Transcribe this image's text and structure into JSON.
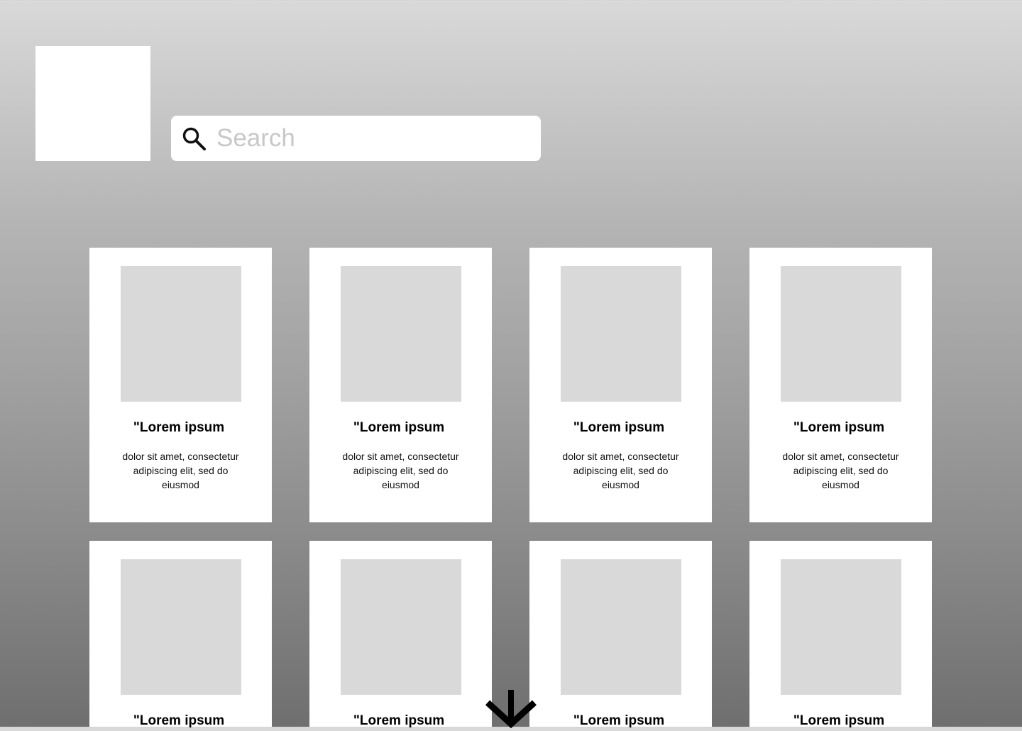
{
  "search": {
    "placeholder": "Search",
    "value": ""
  },
  "cards": [
    {
      "title": "\"Lorem ipsum",
      "description": "dolor sit amet, consectetur adipiscing elit, sed do eiusmod"
    },
    {
      "title": "\"Lorem ipsum",
      "description": "dolor sit amet, consectetur adipiscing elit, sed do eiusmod"
    },
    {
      "title": "\"Lorem ipsum",
      "description": "dolor sit amet, consectetur adipiscing elit, sed do eiusmod"
    },
    {
      "title": "\"Lorem ipsum",
      "description": "dolor sit amet, consectetur adipiscing elit, sed do eiusmod"
    },
    {
      "title": "\"Lorem ipsum",
      "description": ""
    },
    {
      "title": "\"Lorem ipsum",
      "description": ""
    },
    {
      "title": "\"Lorem ipsum",
      "description": ""
    },
    {
      "title": "\"Lorem ipsum",
      "description": ""
    }
  ],
  "icons": {
    "search": "search-icon",
    "scroll": "arrow-down-icon"
  },
  "colors": {
    "background_top": "#d9d9d9",
    "background_bottom": "#6f6f6f",
    "card": "#ffffff",
    "placeholder_image": "#d9d9d9"
  }
}
